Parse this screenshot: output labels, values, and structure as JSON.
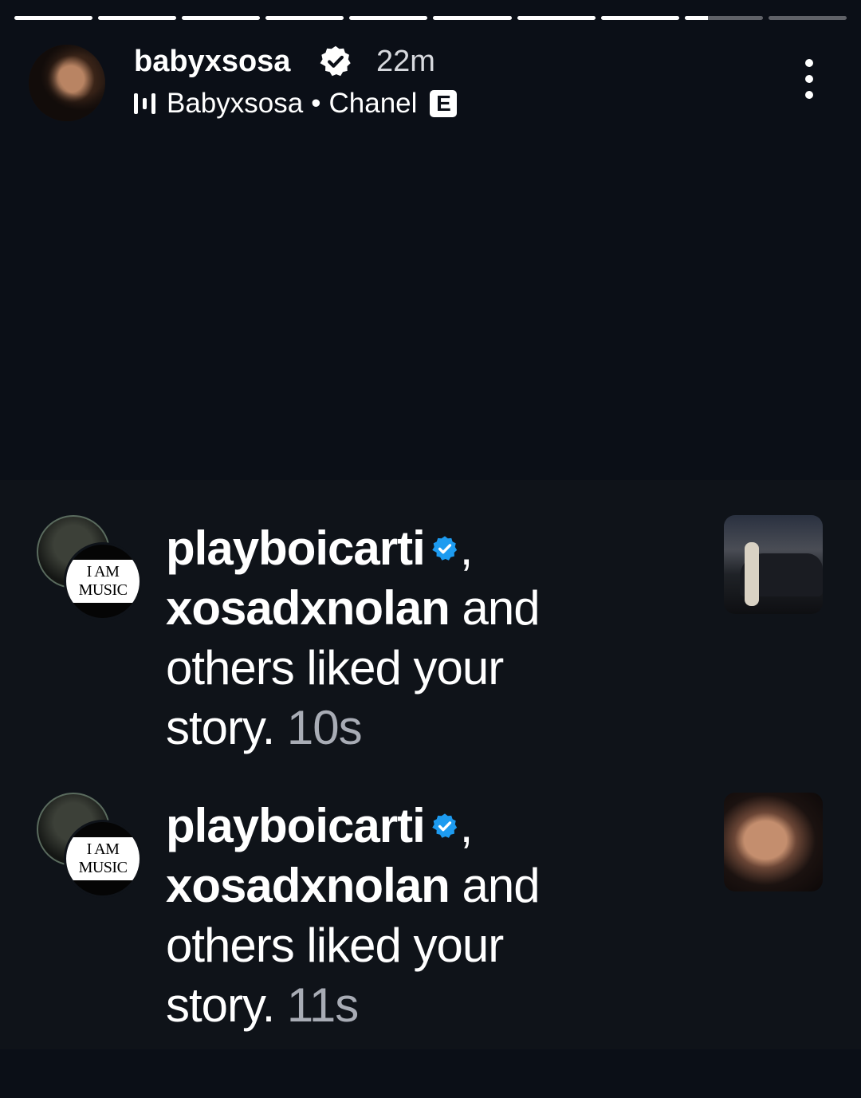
{
  "progress": {
    "segments": 10,
    "completed": 8,
    "current_fraction": 0.3
  },
  "header": {
    "username": "babyxsosa",
    "time": "22m",
    "music": {
      "artist": "Babyxsosa",
      "separator": "•",
      "song": "Chanel",
      "explicit_badge": "E"
    }
  },
  "notifications": [
    {
      "user1": "playboicarti",
      "comma": ",",
      "user2": "xosadxnolan",
      "text": " and others liked your story.",
      "time": "10s",
      "badge": "I AM MUSIC"
    },
    {
      "user1": "playboicarti",
      "comma": ",",
      "user2": "xosadxnolan",
      "text": " and others liked your story.",
      "time": "11s",
      "badge": "I AM MUSIC"
    }
  ],
  "colors": {
    "background": "#0b0f17",
    "verified_blue": "#1d9bf0"
  },
  "icons": [
    "verified-badge-icon",
    "audio-bars-icon",
    "more-options-icon"
  ]
}
